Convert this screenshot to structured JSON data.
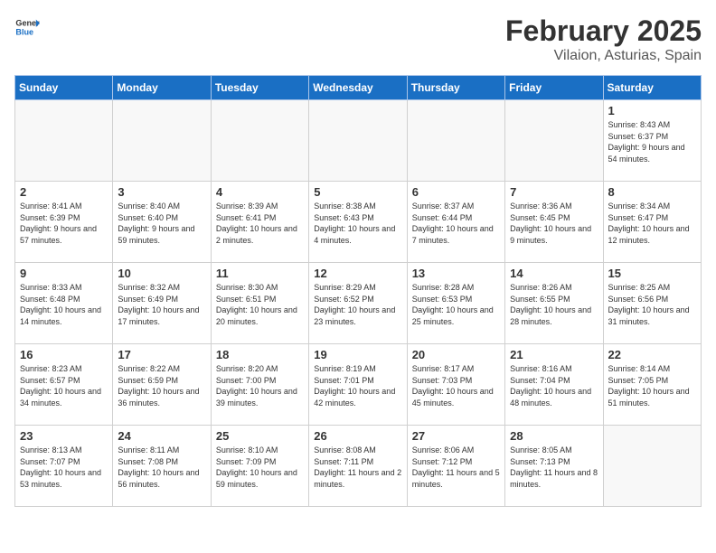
{
  "header": {
    "logo_general": "General",
    "logo_blue": "Blue",
    "title": "February 2025",
    "subtitle": "Vilaion, Asturias, Spain"
  },
  "weekdays": [
    "Sunday",
    "Monday",
    "Tuesday",
    "Wednesday",
    "Thursday",
    "Friday",
    "Saturday"
  ],
  "weeks": [
    [
      {
        "day": "",
        "info": ""
      },
      {
        "day": "",
        "info": ""
      },
      {
        "day": "",
        "info": ""
      },
      {
        "day": "",
        "info": ""
      },
      {
        "day": "",
        "info": ""
      },
      {
        "day": "",
        "info": ""
      },
      {
        "day": "1",
        "info": "Sunrise: 8:43 AM\nSunset: 6:37 PM\nDaylight: 9 hours and 54 minutes."
      }
    ],
    [
      {
        "day": "2",
        "info": "Sunrise: 8:41 AM\nSunset: 6:39 PM\nDaylight: 9 hours and 57 minutes."
      },
      {
        "day": "3",
        "info": "Sunrise: 8:40 AM\nSunset: 6:40 PM\nDaylight: 9 hours and 59 minutes."
      },
      {
        "day": "4",
        "info": "Sunrise: 8:39 AM\nSunset: 6:41 PM\nDaylight: 10 hours and 2 minutes."
      },
      {
        "day": "5",
        "info": "Sunrise: 8:38 AM\nSunset: 6:43 PM\nDaylight: 10 hours and 4 minutes."
      },
      {
        "day": "6",
        "info": "Sunrise: 8:37 AM\nSunset: 6:44 PM\nDaylight: 10 hours and 7 minutes."
      },
      {
        "day": "7",
        "info": "Sunrise: 8:36 AM\nSunset: 6:45 PM\nDaylight: 10 hours and 9 minutes."
      },
      {
        "day": "8",
        "info": "Sunrise: 8:34 AM\nSunset: 6:47 PM\nDaylight: 10 hours and 12 minutes."
      }
    ],
    [
      {
        "day": "9",
        "info": "Sunrise: 8:33 AM\nSunset: 6:48 PM\nDaylight: 10 hours and 14 minutes."
      },
      {
        "day": "10",
        "info": "Sunrise: 8:32 AM\nSunset: 6:49 PM\nDaylight: 10 hours and 17 minutes."
      },
      {
        "day": "11",
        "info": "Sunrise: 8:30 AM\nSunset: 6:51 PM\nDaylight: 10 hours and 20 minutes."
      },
      {
        "day": "12",
        "info": "Sunrise: 8:29 AM\nSunset: 6:52 PM\nDaylight: 10 hours and 23 minutes."
      },
      {
        "day": "13",
        "info": "Sunrise: 8:28 AM\nSunset: 6:53 PM\nDaylight: 10 hours and 25 minutes."
      },
      {
        "day": "14",
        "info": "Sunrise: 8:26 AM\nSunset: 6:55 PM\nDaylight: 10 hours and 28 minutes."
      },
      {
        "day": "15",
        "info": "Sunrise: 8:25 AM\nSunset: 6:56 PM\nDaylight: 10 hours and 31 minutes."
      }
    ],
    [
      {
        "day": "16",
        "info": "Sunrise: 8:23 AM\nSunset: 6:57 PM\nDaylight: 10 hours and 34 minutes."
      },
      {
        "day": "17",
        "info": "Sunrise: 8:22 AM\nSunset: 6:59 PM\nDaylight: 10 hours and 36 minutes."
      },
      {
        "day": "18",
        "info": "Sunrise: 8:20 AM\nSunset: 7:00 PM\nDaylight: 10 hours and 39 minutes."
      },
      {
        "day": "19",
        "info": "Sunrise: 8:19 AM\nSunset: 7:01 PM\nDaylight: 10 hours and 42 minutes."
      },
      {
        "day": "20",
        "info": "Sunrise: 8:17 AM\nSunset: 7:03 PM\nDaylight: 10 hours and 45 minutes."
      },
      {
        "day": "21",
        "info": "Sunrise: 8:16 AM\nSunset: 7:04 PM\nDaylight: 10 hours and 48 minutes."
      },
      {
        "day": "22",
        "info": "Sunrise: 8:14 AM\nSunset: 7:05 PM\nDaylight: 10 hours and 51 minutes."
      }
    ],
    [
      {
        "day": "23",
        "info": "Sunrise: 8:13 AM\nSunset: 7:07 PM\nDaylight: 10 hours and 53 minutes."
      },
      {
        "day": "24",
        "info": "Sunrise: 8:11 AM\nSunset: 7:08 PM\nDaylight: 10 hours and 56 minutes."
      },
      {
        "day": "25",
        "info": "Sunrise: 8:10 AM\nSunset: 7:09 PM\nDaylight: 10 hours and 59 minutes."
      },
      {
        "day": "26",
        "info": "Sunrise: 8:08 AM\nSunset: 7:11 PM\nDaylight: 11 hours and 2 minutes."
      },
      {
        "day": "27",
        "info": "Sunrise: 8:06 AM\nSunset: 7:12 PM\nDaylight: 11 hours and 5 minutes."
      },
      {
        "day": "28",
        "info": "Sunrise: 8:05 AM\nSunset: 7:13 PM\nDaylight: 11 hours and 8 minutes."
      },
      {
        "day": "",
        "info": ""
      }
    ]
  ]
}
